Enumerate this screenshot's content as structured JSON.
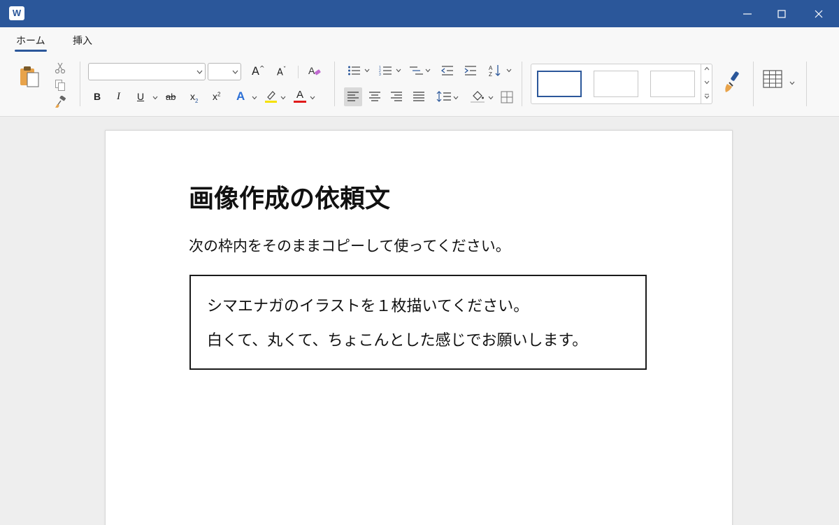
{
  "app": {
    "icon_letter": "W"
  },
  "ribbon": {
    "tabs": [
      {
        "label": "ホーム",
        "active": true
      },
      {
        "label": "挿入",
        "active": false
      }
    ],
    "font_name": "",
    "font_size": "",
    "buttons": {
      "bold": "B",
      "italic": "I",
      "underline": "U",
      "strike": "ab",
      "subscript": "x",
      "superscript": "x",
      "text_effects": "A",
      "font_color": "A",
      "grow_font": "A",
      "shrink_font": "A"
    },
    "colors": {
      "accent": "#2b579a",
      "highlight": "#f5e100",
      "font_color": "#e01b1b"
    }
  },
  "document": {
    "title": "画像作成の依頼文",
    "intro": "次の枠内をそのままコピーして使ってください。",
    "box_lines": [
      "シマエナガのイラストを１枚描いてください。",
      "白くて、丸くて、ちょこんとした感じでお願いします。"
    ]
  }
}
